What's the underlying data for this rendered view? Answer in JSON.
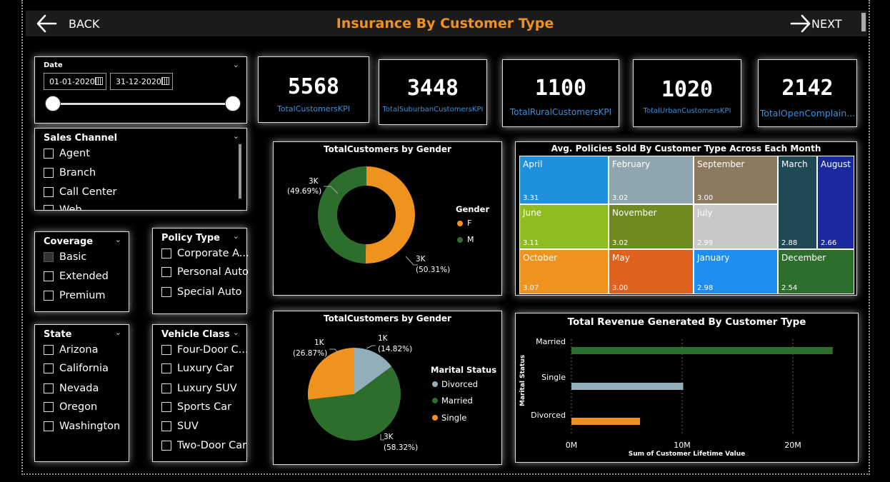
{
  "nav": {
    "back_label": "BACK",
    "next_label": "NEXT",
    "title": "Insurance By Customer Type"
  },
  "date_slicer": {
    "title": "Date",
    "start": "01-01-2020",
    "end": "31-12-2020"
  },
  "sales_channel": {
    "title": "Sales Channel",
    "items": [
      "Agent",
      "Branch",
      "Call Center",
      "Web"
    ]
  },
  "coverage": {
    "title": "Coverage",
    "items": [
      "Basic",
      "Extended",
      "Premium"
    ]
  },
  "policy_type": {
    "title": "Policy Type",
    "items": [
      "Corporate A...",
      "Personal Auto",
      "Special Auto"
    ]
  },
  "state": {
    "title": "State",
    "items": [
      "Arizona",
      "California",
      "Nevada",
      "Oregon",
      "Washington"
    ]
  },
  "vehicle_class": {
    "title": "Vehicle Class",
    "items": [
      "Four-Door C...",
      "Luxury Car",
      "Luxury SUV",
      "Sports Car",
      "SUV",
      "Two-Door Car"
    ]
  },
  "kpis": [
    {
      "value": "5568",
      "label": "TotalCustomersKPI"
    },
    {
      "value": "3448",
      "label": "TotalSuburbanCustomersKPI"
    },
    {
      "value": "1100",
      "label": "TotalRuralCustomersKPI"
    },
    {
      "value": "1020",
      "label": "TotalUrbanCustomersKPI"
    },
    {
      "value": "2142",
      "label": "TotalOpenComplain..."
    }
  ],
  "chart_data": [
    {
      "type": "pie",
      "title": "TotalCustomers by Gender",
      "legend_title": "Gender",
      "legend_position": "right",
      "donut": true,
      "labels": [
        "F",
        "M"
      ],
      "values": [
        50.31,
        49.69
      ],
      "display": [
        "3K",
        "3K"
      ],
      "percent_text": [
        "(50.31%)",
        "(49.69%)"
      ],
      "colors": [
        "#f0921e",
        "#2d6e2d"
      ]
    },
    {
      "type": "heatmap",
      "title": "Avg. Policies Sold By Customer Type Across Each Month",
      "cells": [
        {
          "name": "April",
          "value": "3.31",
          "color": "#1e90dc"
        },
        {
          "name": "February",
          "value": "3.02",
          "color": "#8fa5b0"
        },
        {
          "name": "September",
          "value": "3.00",
          "color": "#8c7a5e"
        },
        {
          "name": "March",
          "value": "2.88",
          "color": "#1f4a54"
        },
        {
          "name": "August",
          "value": "2.66",
          "color": "#1a2a9e"
        },
        {
          "name": "June",
          "value": "3.11",
          "color": "#8fbc1e"
        },
        {
          "name": "November",
          "value": "3.02",
          "color": "#6f8a1f"
        },
        {
          "name": "July",
          "value": "2.99",
          "color": "#c8c8c8"
        },
        {
          "name": "October",
          "value": "3.07",
          "color": "#f0921e"
        },
        {
          "name": "May",
          "value": "3.00",
          "color": "#e0601e"
        },
        {
          "name": "January",
          "value": "2.98",
          "color": "#1e8ef0"
        },
        {
          "name": "December",
          "value": "2.54",
          "color": "#2d6e2d"
        }
      ]
    },
    {
      "type": "pie",
      "title": "TotalCustomers by Gender",
      "legend_title": "Marital Status",
      "legend_position": "right",
      "labels": [
        "Divorced",
        "Married",
        "Single"
      ],
      "values": [
        14.82,
        58.32,
        26.87
      ],
      "display": [
        "1K",
        "3K",
        "1K"
      ],
      "percent_text": [
        "(14.82%)",
        "(58.32%)",
        "(26.87%)"
      ],
      "colors": [
        "#93aebb",
        "#2d6e2d",
        "#f0921e"
      ]
    },
    {
      "type": "bar",
      "orientation": "horizontal",
      "title": "Total Revenue Generated By Customer Type",
      "ylabel": "Marital Status",
      "xlabel": "Sum of Customer Lifetime Value",
      "categories": [
        "Married",
        "Single",
        "Divorced"
      ],
      "values": [
        23600000,
        10100000,
        6200000
      ],
      "colors": [
        "#2d6e2d",
        "#93aebb",
        "#f0921e"
      ],
      "xticks": [
        "0M",
        "10M",
        "20M"
      ],
      "xlim": [
        0,
        20000000
      ],
      "grid": true
    }
  ]
}
